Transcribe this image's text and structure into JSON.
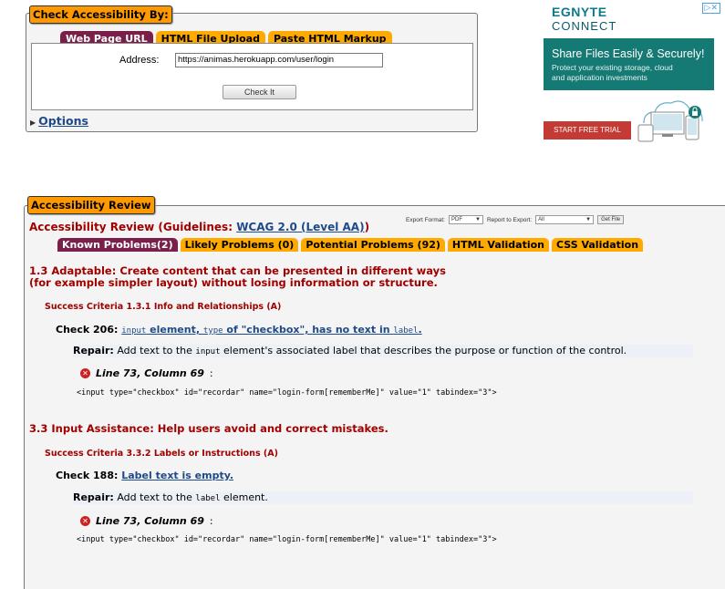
{
  "check_panel": {
    "legend": "Check Accessibility By:",
    "tabs": [
      "Web Page URL",
      "HTML File Upload",
      "Paste HTML Markup"
    ],
    "address_label": "Address:",
    "address_value": "https://animas.herokuapp.com/user/login",
    "check_button": "Check It",
    "options_label": "Options"
  },
  "ad": {
    "choices": "▷✕",
    "logo_top": "EGNYTE",
    "logo_bottom": "CONNECT",
    "headline": "Share Files Easily & Securely!",
    "body_line1": "Protect your existing storage, cloud",
    "body_line2": "and application investments",
    "cta": "START FREE TRIAL"
  },
  "review": {
    "legend": "Accessibility Review",
    "title_prefix": "Accessibility Review (Guidelines: ",
    "title_link": "WCAG 2.0 (Level AA)",
    "title_suffix": ")",
    "export_format_label": "Export Format:",
    "export_format_value": "PDF",
    "report_to_export_label": "Report to Export:",
    "report_to_export_value": "All",
    "get_file": "Get File",
    "tabs": [
      "Known Problems(2)",
      "Likely Problems (0)",
      "Potential Problems (92)",
      "HTML Validation",
      "CSS Validation"
    ],
    "guideline1_line1": "1.3 Adaptable: Create content that can be presented in different ways",
    "guideline1_line2": "(for example simpler layout) without losing information or structure.",
    "criteria1": "Success Criteria 1.3.1 Info and Relationships (A)",
    "check1_prefix": "Check 206: ",
    "check1_code1": "input",
    "check1_mid1": " element, ",
    "check1_code2": "type",
    "check1_mid2": " of \"checkbox\", has no text in ",
    "check1_code3": "label",
    "check1_end": ".",
    "repair_label": "Repair:",
    "repair1_a": " Add text to the ",
    "repair1_code": "input",
    "repair1_b": " element's associated label that describes the purpose or function of the control.",
    "location1": "Line 73, Column 69",
    "code1": "<input type=\"checkbox\" id=\"recordar\" name=\"login-form[rememberMe]\" value=\"1\" tabindex=\"3\">",
    "guideline2": "3.3 Input Assistance: Help users avoid and correct mistakes.",
    "criteria2": "Success Criteria 3.3.2 Labels or Instructions (A)",
    "check2_prefix": "Check 188: ",
    "check2_link": "Label text is empty.",
    "repair2_a": " Add text to the ",
    "repair2_code": "label",
    "repair2_b": " element.",
    "location2": "Line 73, Column 69",
    "code2": "<input type=\"checkbox\" id=\"recordar\" name=\"login-form[rememberMe]\" value=\"1\" tabindex=\"3\">"
  },
  "colors": {
    "legend_orange": "#ff9900",
    "active_tab": "#7a1f4a",
    "heading_red": "#a00000",
    "link_blue": "#1d4a8a"
  }
}
